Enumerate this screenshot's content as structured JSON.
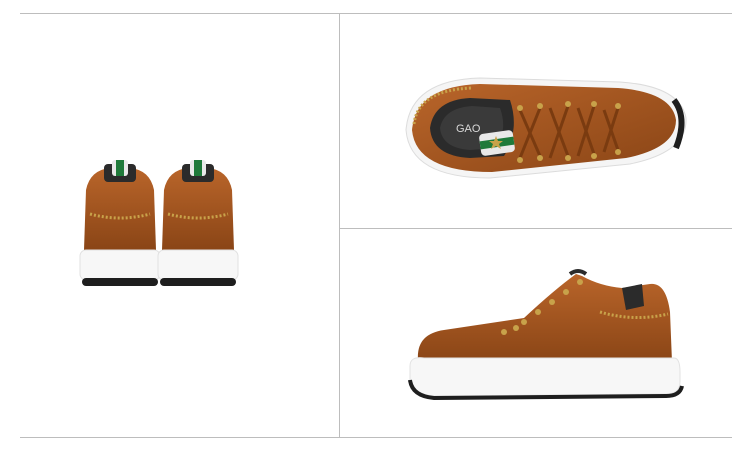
{
  "gallery": {
    "panels": [
      {
        "view": "rear-view-pair",
        "brand_text": ""
      },
      {
        "view": "top-view",
        "brand_text": "GAO"
      },
      {
        "view": "side-view",
        "brand_text": ""
      }
    ]
  },
  "colors": {
    "leather": "#9c4f1d",
    "leather_light": "#b9652a",
    "leather_dark": "#6e3510",
    "sole": "#f7f7f7",
    "outsole": "#1e1e1e",
    "studs": "#c8a24a",
    "lining": "#2b2b2b",
    "stripe_green": "#1f7a3a",
    "divider": "#bdbdbd"
  }
}
